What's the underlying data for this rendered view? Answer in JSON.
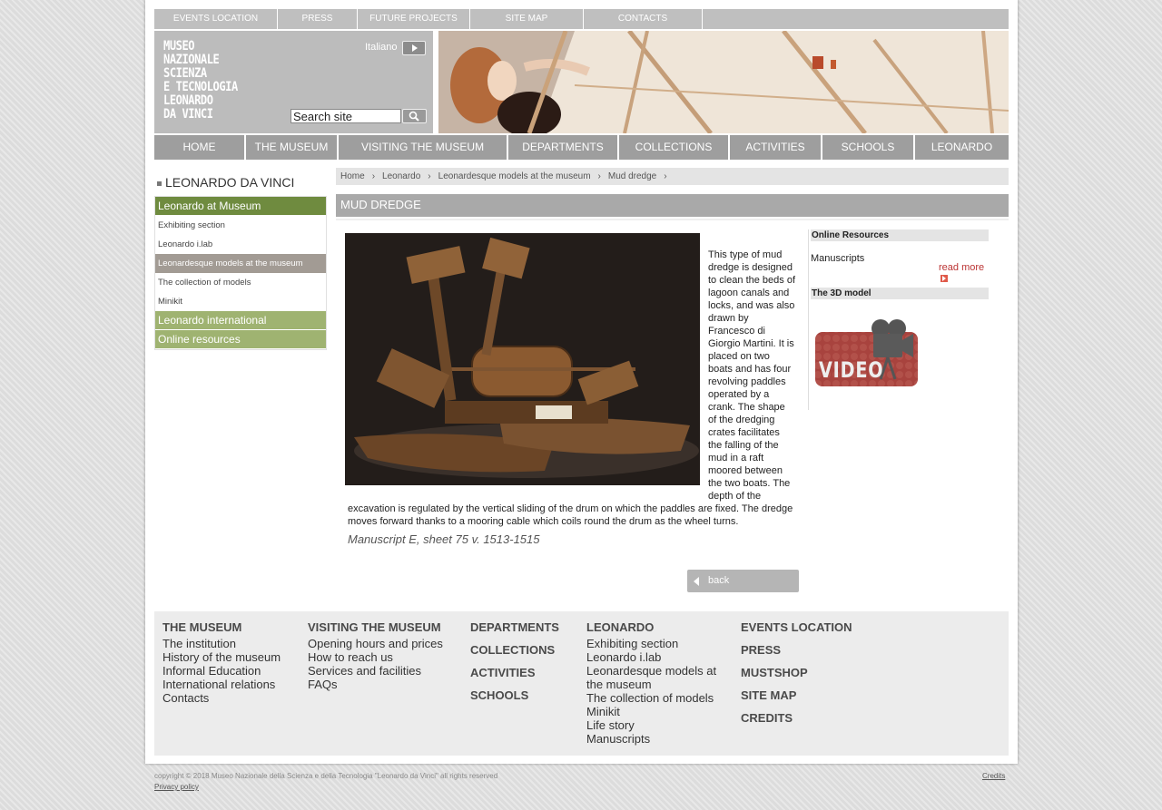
{
  "top_nav": [
    "EVENTS LOCATION",
    "PRESS",
    "FUTURE PROJECTS",
    "SITE MAP",
    "CONTACTS"
  ],
  "brand": {
    "logo_lines": [
      "MUSEO",
      "NAZIONALE",
      "SCIENZA",
      "E TECNOLOGIA",
      "LEONARDO",
      "DA VINCI"
    ],
    "language_label": "Italiano",
    "search_placeholder": "Search site"
  },
  "main_nav": [
    "HOME",
    "THE MUSEUM",
    "VISITING THE MUSEUM",
    "DEPARTMENTS",
    "COLLECTIONS",
    "ACTIVITIES",
    "SCHOOLS",
    "LEONARDO"
  ],
  "sidebar": {
    "title": "LEONARDO DA VINCI",
    "items": [
      {
        "label": "Leonardo at Museum",
        "style": "green"
      },
      {
        "label": "Exhibiting section",
        "style": "plain"
      },
      {
        "label": "Leonardo i.lab",
        "style": "plain"
      },
      {
        "label": "Leonardesque models at the museum",
        "style": "active"
      },
      {
        "label": "The collection of models",
        "style": "plain"
      },
      {
        "label": "Minikit",
        "style": "plain"
      },
      {
        "label": "Leonardo international",
        "style": "lgreen"
      },
      {
        "label": "Online resources",
        "style": "lgreen"
      }
    ]
  },
  "breadcrumb": [
    "Home",
    "Leonardo",
    "Leonardesque models at the museum",
    "Mud dredge"
  ],
  "content": {
    "title": "MUD DREDGE",
    "description": "This type of mud dredge is designed to clean the beds of lagoon canals and locks, and was also drawn by Francesco di Giorgio Martini. It is placed on two boats and has four revolving paddles operated by a crank. The shape of the dredging crates facilitates the falling of the mud in a raft moored between the two boats. The depth of the excavation is regulated by the vertical sliding of the drum on which the paddles are fixed. The dredge moves forward thanks to a mooring cable which coils round the drum as the wheel turns.",
    "caption": "Manuscript E, sheet 75 v. 1513-1515",
    "back_label": "back"
  },
  "right_box": {
    "online_resources_heading": "Online Resources",
    "manuscripts_label": "Manuscripts",
    "read_more_label": "read more",
    "model_heading": "The 3D model",
    "video_label": "VIDEO"
  },
  "footer": {
    "museum": {
      "heading": "THE MUSEUM",
      "links": [
        "The institution",
        "History of the museum",
        "Informal Education",
        "International relations",
        "Contacts"
      ]
    },
    "visiting": {
      "heading": "VISITING THE MUSEUM",
      "links": [
        "Opening hours and prices",
        "How to reach us",
        "Services and facilities",
        "FAQs"
      ]
    },
    "col3": [
      "DEPARTMENTS",
      "COLLECTIONS",
      "ACTIVITIES",
      "SCHOOLS"
    ],
    "leonardo": {
      "heading": "LEONARDO",
      "links": [
        "Exhibiting section",
        "Leonardo i.lab",
        "Leonardesque models at the museum",
        "The collection of models",
        "Minikit",
        "Life story",
        "Manuscripts"
      ]
    },
    "col5": [
      "EVENTS LOCATION",
      "PRESS",
      "MUSTSHOP",
      "SITE MAP",
      "CREDITS"
    ]
  },
  "bottom": {
    "copyright": "copyright © 2018 Museo Nazionale della Scienza e della Tecnologia \"Leonardo da Vinci\" all rights reserved",
    "privacy": "Privacy policy",
    "credits": "Credits"
  },
  "colors": {
    "sidebar_green": "#6f8b3f",
    "sidebar_light_green": "#9fb371",
    "nav_gray": "#9e9e9e",
    "read_more_red": "#e05a4a"
  }
}
